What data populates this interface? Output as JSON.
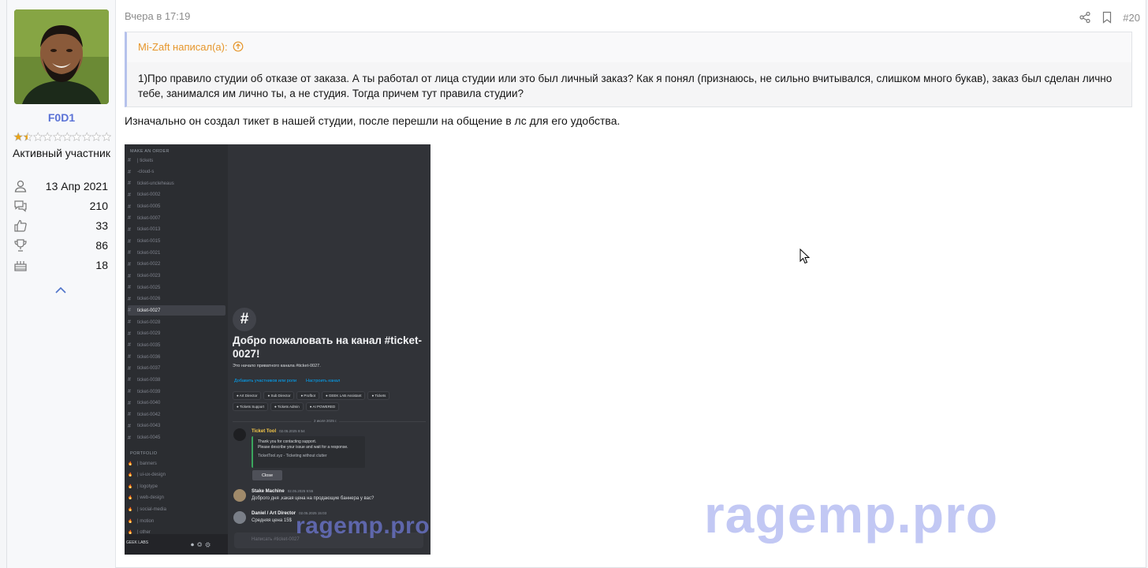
{
  "user": {
    "name": "F0D1",
    "title": "Активный участник",
    "stats": [
      {
        "icon": "user-icon",
        "value": "13 Апр 2021"
      },
      {
        "icon": "messages-icon",
        "value": "210"
      },
      {
        "icon": "thumbs-up-icon",
        "value": "33"
      },
      {
        "icon": "trophy-icon",
        "value": "86"
      },
      {
        "icon": "cake-icon",
        "value": "18"
      }
    ],
    "rating": {
      "filled": 1.5,
      "total": 10
    }
  },
  "post": {
    "date": "Вчера в 17:19",
    "number": "#20",
    "quote_author": "Mi-Zaft написал(а):",
    "quote_text": "1)Про правило студии об отказе от заказа. А ты работал от лица студии или это был личный заказ? Как я понял (признаюсь, не сильно вчитывался, слишком много букав), заказ был сделан лично тебе, занимался им лично ты, а не студия. Тогда причем тут правила студии?",
    "message": "Изначально он создал тикет в нашей студии, после перешли на общение в лс для его удобства."
  },
  "screenshot": {
    "category_orders": "MAKE AN ORDER",
    "category_portfolio": "PORTFOLIO",
    "channels": [
      "| tickets",
      "-cloud-s",
      "ticket-uncleheaus",
      "ticket-0002",
      "ticket-0005",
      "ticket-0007",
      "ticket-0013",
      "ticket-0015",
      "ticket-0021",
      "ticket-0022",
      "ticket-0023",
      "ticket-0025",
      "ticket-0026",
      "ticket-0027",
      "ticket-0028",
      "ticket-0029",
      "ticket-0035",
      "ticket-0036",
      "ticket-0037",
      "ticket-0038",
      "ticket-0039",
      "ticket-0040",
      "ticket-0042",
      "ticket-0043",
      "ticket-0045"
    ],
    "portfolio_channels": [
      "| banners",
      "| ui-ux-design",
      "| logotype",
      "| web-design",
      "| social-media",
      "| motion",
      "| other"
    ],
    "active_channel": "ticket-0027",
    "welcome": "Добро пожаловать на канал #ticket-0027!",
    "welcome_sub": "Это начало приватного канала #ticket-0027.",
    "link_add": "Добавить участников или роли",
    "link_setup": "Настроить канал",
    "roles": [
      "Art Director",
      "Sub Director",
      "Profbot",
      "GEEK LAB Assistant",
      "Tickets",
      "Tickets Support",
      "Tickets Admin",
      "AI POWERED"
    ],
    "date_divider": "2 июля 2025 г.",
    "bot_name": "Ticket Tool",
    "bot_time": "02.05.2025 9:54",
    "embed_line1": "Thank you for contacting support.",
    "embed_line2": "Please describe your issue and wait for a response.",
    "embed_footer": "TicketTool.xyz - Ticketing without clutter",
    "close_button": "Close",
    "msg1_author": "Stake Machine",
    "msg1_time": "02.05.2025 9:55",
    "msg1_text": "Доброго дня ,какая цена на продающие баннера у вас?",
    "msg2_author": "Daniel / Art Director",
    "msg2_time": "02.05.2025 15:03",
    "msg2_text": "Средняя цена 15$",
    "input_placeholder": "Написать #ticket-0027",
    "user_bar": "GEEK LABS",
    "watermark": "ragemp.pro"
  },
  "page_watermark": "ragemp.pro",
  "colors": {
    "username": "#5a72d6",
    "quote_author": "#e6962b",
    "quote_border": "#b6c2ec"
  }
}
